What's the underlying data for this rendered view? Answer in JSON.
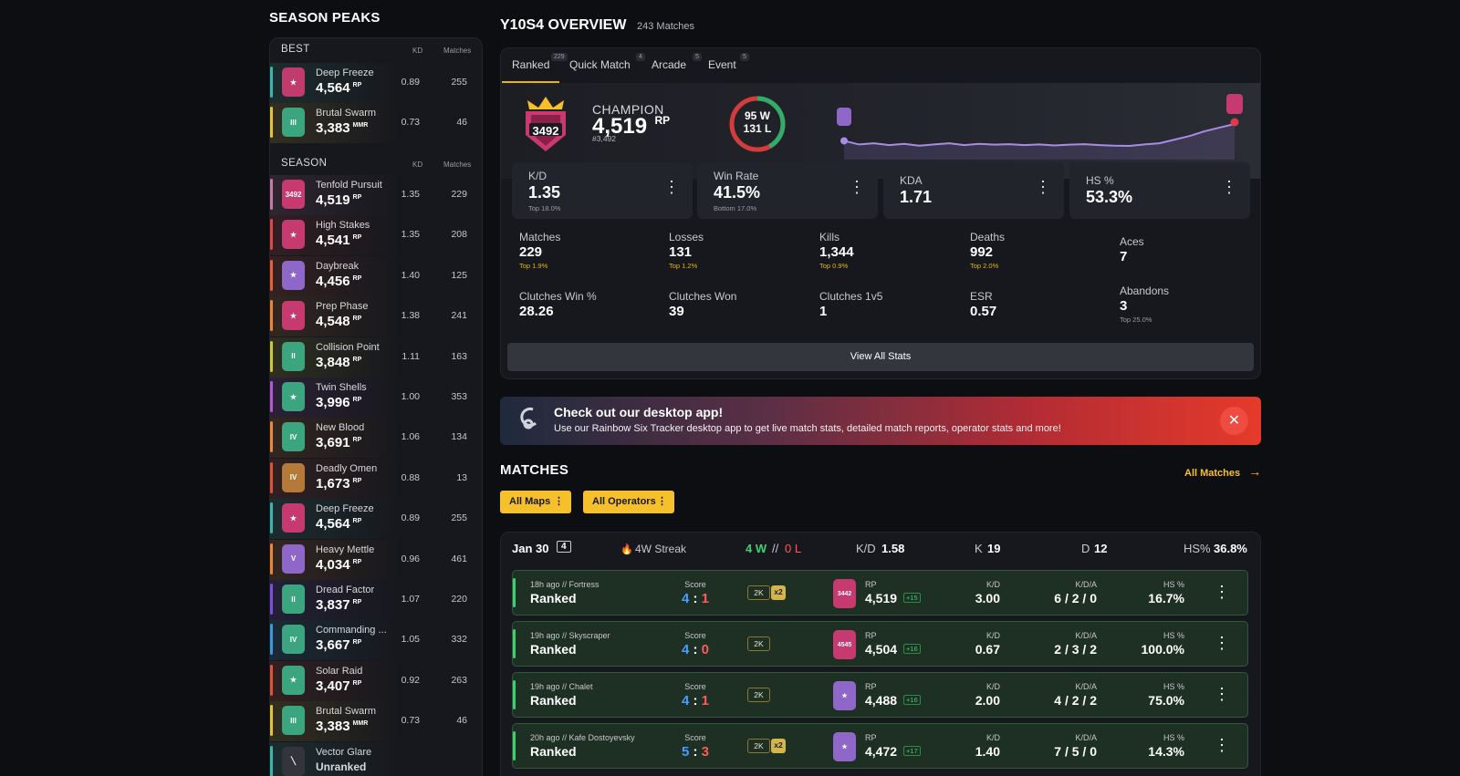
{
  "season_peaks": {
    "title": "SEASON PEAKS",
    "best_header": "BEST",
    "season_header": "SEASON",
    "col_kd": "KD",
    "col_matches": "Matches",
    "best": [
      {
        "name": "Deep Freeze",
        "value": "4,564",
        "unit": "RP",
        "kd": "0.89",
        "matches": "255",
        "color": "#3fb3a5",
        "emblem_color": "#c13b6c",
        "emblem": "★"
      },
      {
        "name": "Brutal Swarm",
        "value": "3,383",
        "unit": "MMR",
        "kd": "0.73",
        "matches": "46",
        "color": "#e3c53a",
        "emblem_color": "#3aa57e",
        "emblem": "III"
      }
    ],
    "season": [
      {
        "name": "Tenfold Pursuit",
        "value": "4,519",
        "unit": "RP",
        "kd": "1.35",
        "matches": "229",
        "color": "#c37ca8",
        "emblem_color": "#c63a6f",
        "emblem": "3492"
      },
      {
        "name": "High Stakes",
        "value": "4,541",
        "unit": "RP",
        "kd": "1.35",
        "matches": "208",
        "color": "#d94848",
        "emblem_color": "#c63a6f",
        "emblem": "★"
      },
      {
        "name": "Daybreak",
        "value": "4,456",
        "unit": "RP",
        "kd": "1.40",
        "matches": "125",
        "color": "#e8603a",
        "emblem_color": "#8e67c9",
        "emblem": "★"
      },
      {
        "name": "Prep Phase",
        "value": "4,548",
        "unit": "RP",
        "kd": "1.38",
        "matches": "241",
        "color": "#e8873a",
        "emblem_color": "#c63a6f",
        "emblem": "★"
      },
      {
        "name": "Collision Point",
        "value": "3,848",
        "unit": "RP",
        "kd": "1.11",
        "matches": "163",
        "color": "#c9c93a",
        "emblem_color": "#3aa57e",
        "emblem": "II"
      },
      {
        "name": "Twin Shells",
        "value": "3,996",
        "unit": "RP",
        "kd": "1.00",
        "matches": "353",
        "color": "#b25ad6",
        "emblem_color": "#3aa57e",
        "emblem": "★"
      },
      {
        "name": "New Blood",
        "value": "3,691",
        "unit": "RP",
        "kd": "1.06",
        "matches": "134",
        "color": "#e88a3a",
        "emblem_color": "#3aa57e",
        "emblem": "IV"
      },
      {
        "name": "Deadly Omen",
        "value": "1,673",
        "unit": "RP",
        "kd": "0.88",
        "matches": "13",
        "color": "#d9543a",
        "emblem_color": "#b57a3a",
        "emblem": "IV"
      },
      {
        "name": "Deep Freeze",
        "value": "4,564",
        "unit": "RP",
        "kd": "0.89",
        "matches": "255",
        "color": "#3fb3a5",
        "emblem_color": "#c63a6f",
        "emblem": "★"
      },
      {
        "name": "Heavy Mettle",
        "value": "4,034",
        "unit": "RP",
        "kd": "0.96",
        "matches": "461",
        "color": "#e8873a",
        "emblem_color": "#8e67c9",
        "emblem": "V"
      },
      {
        "name": "Dread Factor",
        "value": "3,837",
        "unit": "RP",
        "kd": "1.07",
        "matches": "220",
        "color": "#7b4fd6",
        "emblem_color": "#3aa57e",
        "emblem": "II"
      },
      {
        "name": "Commanding ...",
        "value": "3,667",
        "unit": "RP",
        "kd": "1.05",
        "matches": "332",
        "color": "#3a9ad9",
        "emblem_color": "#3aa57e",
        "emblem": "IV"
      },
      {
        "name": "Solar Raid",
        "value": "3,407",
        "unit": "RP",
        "kd": "0.92",
        "matches": "263",
        "color": "#d9543a",
        "emblem_color": "#3aa57e",
        "emblem": "★"
      },
      {
        "name": "Brutal Swarm",
        "value": "3,383",
        "unit": "MMR",
        "kd": "0.73",
        "matches": "46",
        "color": "#e3c53a",
        "emblem_color": "#3aa57e",
        "emblem": "III"
      },
      {
        "name": "Vector Glare",
        "value": "Unranked",
        "unit": "",
        "kd": "",
        "matches": "",
        "color": "#3fb3a5",
        "emblem_color": "#33353b",
        "emblem": "╲"
      }
    ]
  },
  "overview": {
    "title": "Y10S4 OVERVIEW",
    "match_count": "243 Matches",
    "tabs": [
      {
        "label": "Ranked",
        "count": "229"
      },
      {
        "label": "Quick Match",
        "count": "4"
      },
      {
        "label": "Arcade",
        "count": "5"
      },
      {
        "label": "Event",
        "count": "5"
      }
    ],
    "rank_badge": "3492",
    "rank_name": "CHAMPION",
    "rank_value": "4,519",
    "rank_unit": "RP",
    "rank_pos": "#3,492",
    "wins": "95 W",
    "losses": "131 L",
    "win_fraction": 0.42,
    "rp_history": [
      4220,
      4190,
      4200,
      4185,
      4195,
      4180,
      4190,
      4200,
      4185,
      4195,
      4188,
      4192,
      4185,
      4190,
      4182,
      4188,
      4192,
      4185,
      4180,
      4178,
      4190,
      4200,
      4230,
      4260,
      4300,
      4330,
      4360
    ],
    "stat_boxes": [
      {
        "label": "K/D",
        "value": "1.35",
        "sub": "Top 18.0%"
      },
      {
        "label": "Win Rate",
        "value": "41.5%",
        "sub": "Bottom 17.0%"
      },
      {
        "label": "KDA",
        "value": "1.71",
        "sub": ""
      },
      {
        "label": "HS %",
        "value": "53.3%",
        "sub": ""
      }
    ],
    "grid": [
      {
        "label": "Matches",
        "value": "229",
        "sub": "Top 1.9%"
      },
      {
        "label": "Losses",
        "value": "131",
        "sub": "Top 1.2%"
      },
      {
        "label": "Kills",
        "value": "1,344",
        "sub": "Top 0.9%"
      },
      {
        "label": "Deaths",
        "value": "992",
        "sub": "Top 2.0%"
      },
      {
        "label": "Aces",
        "value": "7",
        "sub": ""
      },
      {
        "label": "Clutches Win %",
        "value": "28.26",
        "sub": ""
      },
      {
        "label": "Clutches Won",
        "value": "39",
        "sub": ""
      },
      {
        "label": "Clutches 1v5",
        "value": "1",
        "sub": ""
      },
      {
        "label": "ESR",
        "value": "0.57",
        "sub": ""
      },
      {
        "label": "Abandons",
        "value": "3",
        "sub": "Top 25.0%"
      }
    ],
    "view_all": "View All Stats"
  },
  "banner": {
    "title": "Check out our desktop app!",
    "subtitle": "Use our Rainbow Six Tracker desktop app to get live match stats, detailed match reports, operator stats and more!",
    "close": "✕"
  },
  "matches": {
    "title": "MATCHES",
    "all_link": "All Matches",
    "filter_maps": "All Maps",
    "filter_ops": "All Operators",
    "day": {
      "date": "Jan 30",
      "count": "4",
      "streak": "4W Streak",
      "wins": "4 W",
      "sep": "//",
      "losses": "0 L",
      "kd_label": "K/D",
      "kd": "1.58",
      "k_label": "K",
      "k": "19",
      "d_label": "D",
      "d": "12",
      "hs_label": "HS%",
      "hs": "36.8%"
    },
    "labels": {
      "score": "Score",
      "rp": "RP",
      "kd": "K/D",
      "kda": "K/D/A",
      "hs": "HS %"
    },
    "rows": [
      {
        "when": "18h ago // Fortress",
        "mode": "Ranked",
        "s1": "4",
        "s2": "1",
        "multi": "2K",
        "mult": "x2",
        "badge": "3442",
        "badge_color": "#c63a6f",
        "rp": "4,519",
        "delta": "+15",
        "kd": "3.00",
        "kda": "6 / 2 / 0",
        "hs": "16.7%"
      },
      {
        "when": "19h ago // Skyscraper",
        "mode": "Ranked",
        "s1": "4",
        "s2": "0",
        "multi": "2K",
        "mult": "",
        "badge": "4545",
        "badge_color": "#c63a6f",
        "rp": "4,504",
        "delta": "+16",
        "kd": "0.67",
        "kda": "2 / 3 / 2",
        "hs": "100.0%"
      },
      {
        "when": "19h ago // Chalet",
        "mode": "Ranked",
        "s1": "4",
        "s2": "1",
        "multi": "2K",
        "mult": "",
        "badge": "★",
        "badge_color": "#8e67c9",
        "rp": "4,488",
        "delta": "+16",
        "kd": "2.00",
        "kda": "4 / 2 / 2",
        "hs": "75.0%"
      },
      {
        "when": "20h ago // Kafe Dostoyevsky",
        "mode": "Ranked",
        "s1": "5",
        "s2": "3",
        "multi": "2K",
        "mult": "x2",
        "badge": "★",
        "badge_color": "#8e67c9",
        "rp": "4,472",
        "delta": "+17",
        "kd": "1.40",
        "kda": "7 / 5 / 0",
        "hs": "14.3%"
      }
    ]
  }
}
